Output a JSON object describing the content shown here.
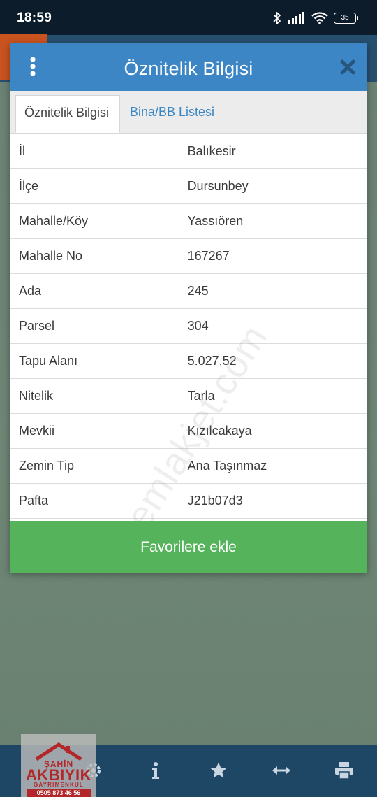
{
  "status_bar": {
    "time": "18:59",
    "battery": "35",
    "icons": [
      "bluetooth-icon",
      "signal-icon",
      "wifi-icon",
      "battery-icon"
    ]
  },
  "dialog": {
    "title": "Öznitelik Bilgisi",
    "menu_icon": "vertical-dots-icon",
    "close_icon": "close-icon",
    "tabs": [
      {
        "label": "Öznitelik Bilgisi",
        "active": true
      },
      {
        "label": "Bina/BB Listesi",
        "active": false
      }
    ],
    "rows": [
      {
        "key": "İl",
        "value": "Balıkesir"
      },
      {
        "key": "İlçe",
        "value": "Dursunbey"
      },
      {
        "key": "Mahalle/Köy",
        "value": "Yassıören"
      },
      {
        "key": "Mahalle No",
        "value": "167267"
      },
      {
        "key": "Ada",
        "value": "245"
      },
      {
        "key": "Parsel",
        "value": "304"
      },
      {
        "key": "Tapu Alanı",
        "value": "5.027,52"
      },
      {
        "key": "Nitelik",
        "value": "Tarla"
      },
      {
        "key": "Mevkii",
        "value": "Kızılcakaya"
      },
      {
        "key": "Zemin Tip",
        "value": "Ana Taşınmaz"
      },
      {
        "key": "Pafta",
        "value": "J21b07d3"
      }
    ],
    "favorite_button": "Favorilere ekle"
  },
  "watermark": "emlakjet.com",
  "logo": {
    "top": "ŞAHİN",
    "main": "AKBIYIK",
    "sub": "GAYRİMENKUL",
    "phone": "0505 873 46 56"
  },
  "bottom_nav": [
    "settings-icon",
    "info-icon",
    "star-icon",
    "measure-icon",
    "print-icon"
  ],
  "colors": {
    "header": "#3c86c6",
    "favorite_button": "#55b45b",
    "tab_inactive_text": "#3a87c3",
    "bottom_nav": "#1e4766"
  }
}
